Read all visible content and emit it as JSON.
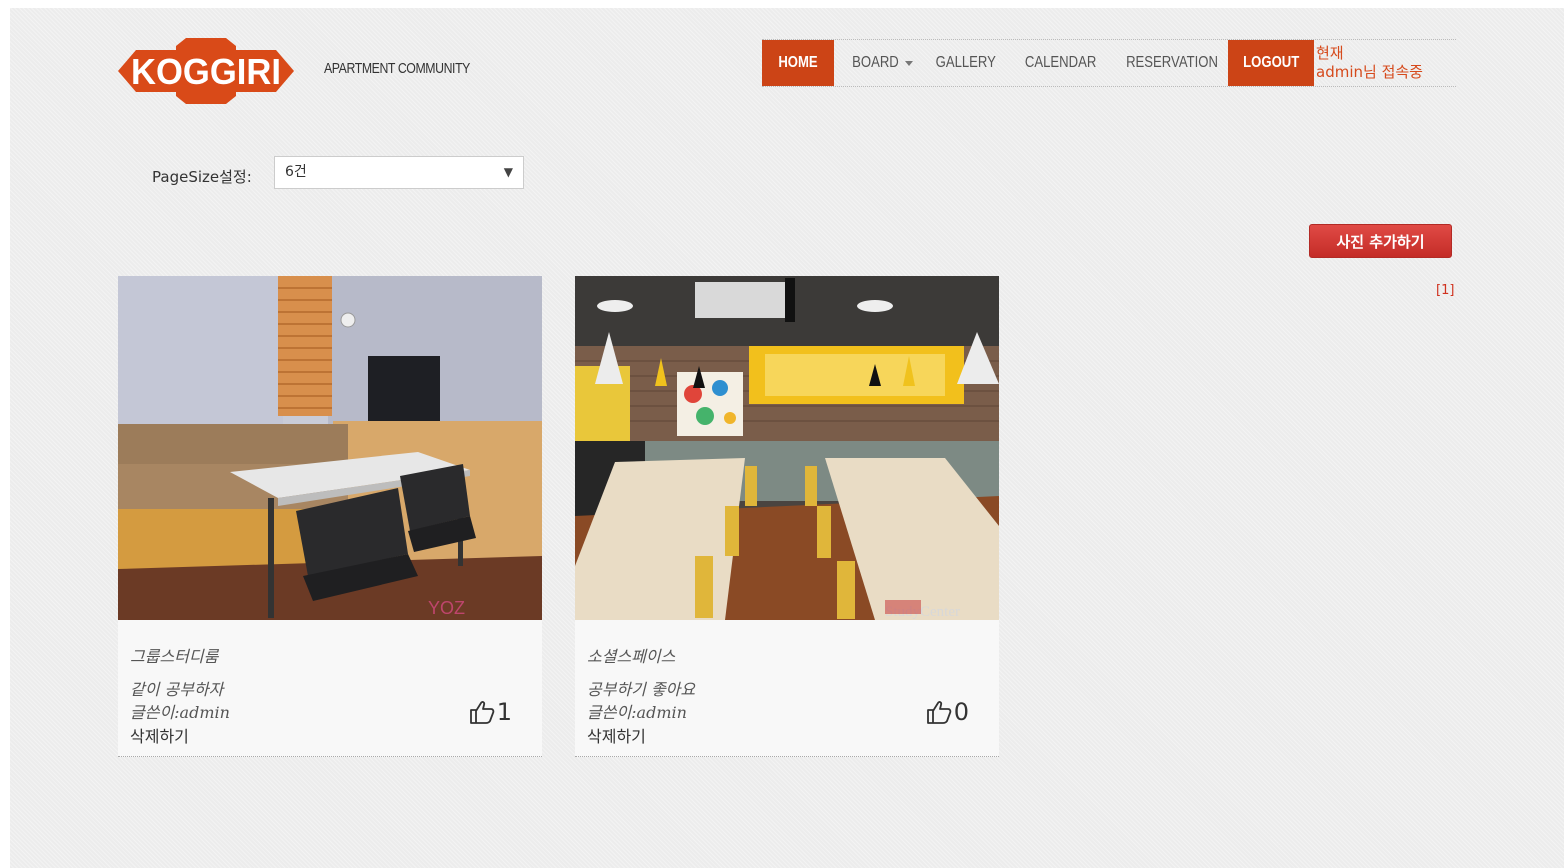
{
  "header": {
    "logo_text": "KOGGIRI",
    "tagline": "APARTMENT COMMUNITY",
    "brand_color": "#cc4416"
  },
  "nav": {
    "home": "HOME",
    "board": "BOARD",
    "gallery": "GALLERY",
    "calendar": "CALENDAR",
    "reservation": "RESERVATION",
    "logout": "LOGOUT",
    "user_line1": "현재",
    "user_line2": "admin님 접속중"
  },
  "pagesize": {
    "label": "PageSize설정:",
    "selected": "6건"
  },
  "actions": {
    "add_photo": "사진 추가하기",
    "pager": "[1]"
  },
  "gallery": [
    {
      "title": "그룹스터디룸",
      "content": "같이 공부하자",
      "author": "글쓴이:admin",
      "delete": "삭제하기",
      "likes": "1",
      "watermark": "YOZ"
    },
    {
      "title": "소셜스페이스",
      "content": "공부하기 좋아요",
      "author": "글쓴이:admin",
      "delete": "삭제하기",
      "likes": "0",
      "watermark": "StudyCenter"
    }
  ]
}
